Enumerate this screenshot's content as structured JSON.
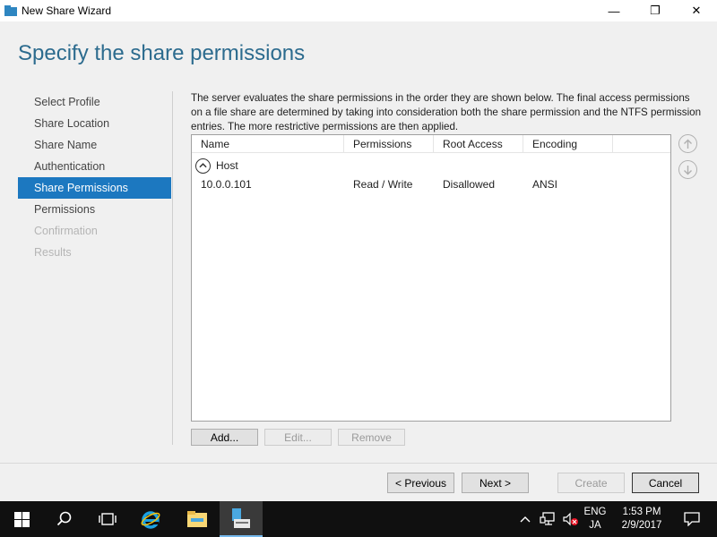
{
  "window": {
    "title": "New Share Wizard",
    "minimize": "—",
    "maximize": "❐",
    "close": "✕"
  },
  "header": {
    "title": "Specify the share permissions"
  },
  "nav": {
    "items": [
      {
        "label": "Select Profile"
      },
      {
        "label": "Share Location"
      },
      {
        "label": "Share Name"
      },
      {
        "label": "Authentication"
      },
      {
        "label": "Share Permissions"
      },
      {
        "label": "Permissions"
      },
      {
        "label": "Confirmation"
      },
      {
        "label": "Results"
      }
    ]
  },
  "description": "The server evaluates the share permissions in the order they are shown below. The final access permissions on a file share are determined by taking into consideration both the share permission and the NTFS permission entries. The more restrictive permissions are then applied.",
  "table": {
    "columns": [
      "Name",
      "Permissions",
      "Root Access",
      "Encoding"
    ],
    "group": "Host",
    "rows": [
      {
        "name": "10.0.0.101",
        "permissions": "Read / Write",
        "root_access": "Disallowed",
        "encoding": "ANSI"
      }
    ]
  },
  "actions": {
    "add": "Add...",
    "edit": "Edit...",
    "remove": "Remove"
  },
  "footer": {
    "previous": "< Previous",
    "next": "Next >",
    "create": "Create",
    "cancel": "Cancel"
  },
  "taskbar": {
    "language": "ENG",
    "input": "JA",
    "time": "1:53 PM",
    "date": "2/9/2017"
  },
  "icons": [
    "windows-start-icon",
    "search-icon",
    "task-view-icon",
    "internet-explorer-icon",
    "file-explorer-icon",
    "server-manager-icon",
    "chevron-up-icon",
    "network-icon",
    "volume-muted-icon",
    "notification-icon"
  ],
  "colors": {
    "accent": "#1c78c0",
    "header": "#2c6b8e"
  }
}
